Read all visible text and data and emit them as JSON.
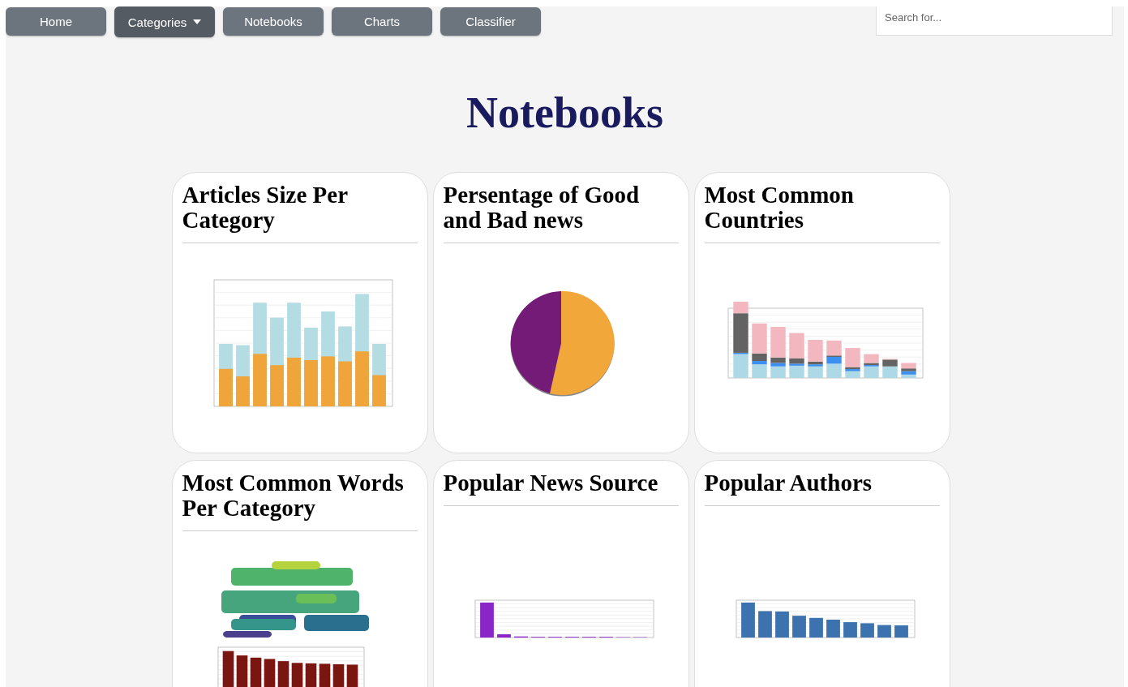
{
  "nav": [
    {
      "label": "Home",
      "kind": "link",
      "selected": false
    },
    {
      "label": "Categories",
      "kind": "dropdown",
      "selected": true
    },
    {
      "label": "Notebooks",
      "kind": "link",
      "selected": false
    },
    {
      "label": "Charts",
      "kind": "link",
      "selected": false
    },
    {
      "label": "Classifier",
      "kind": "link",
      "selected": false
    }
  ],
  "search": {
    "placeholder": "Search for..."
  },
  "heading": "Notebooks",
  "cards": [
    {
      "title": "Articles Size Per Category",
      "chart": {
        "kind": "mean-bars"
      }
    },
    {
      "title": "Persentage of Good and Bad news",
      "chart": {
        "kind": "pie"
      }
    },
    {
      "title": "Most Common Countries",
      "chart": {
        "kind": "stacked-bars"
      }
    },
    {
      "title": "Most Common Words Per Category",
      "chart": {
        "kind": "wordcloud"
      }
    },
    {
      "title": "Popular News Source",
      "chart": {
        "kind": "sources-bars"
      }
    },
    {
      "title": "Popular Authors",
      "chart": {
        "kind": "authors-bars"
      }
    }
  ]
}
